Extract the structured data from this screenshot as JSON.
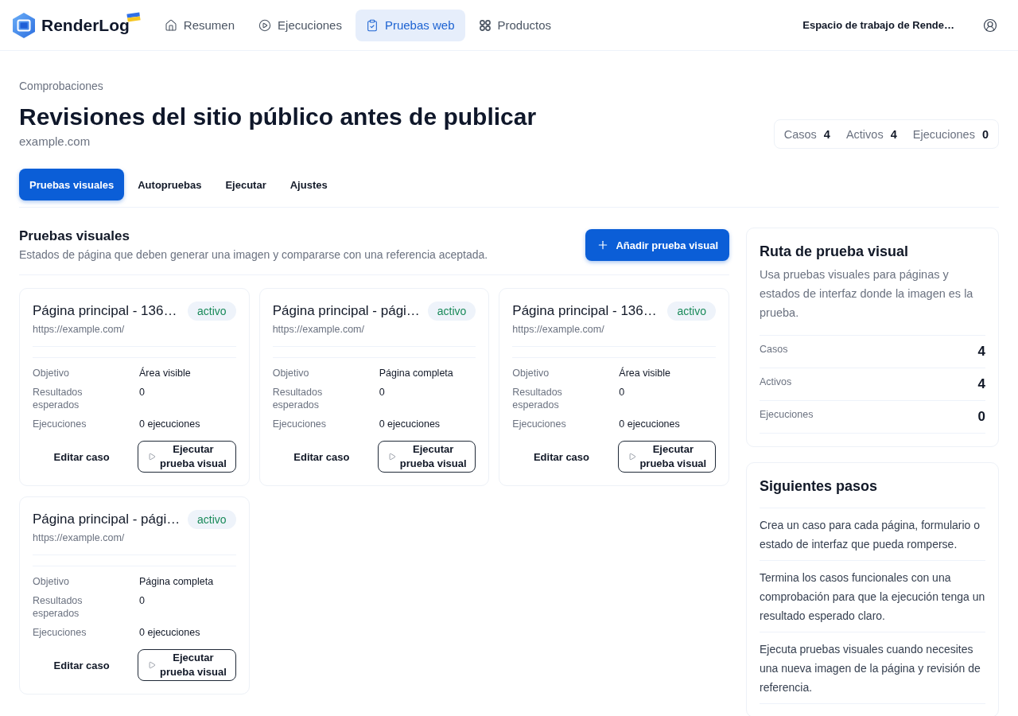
{
  "header": {
    "logo": "RenderLog",
    "nav": [
      {
        "label": "Resumen",
        "selected": false
      },
      {
        "label": "Ejecuciones",
        "selected": false
      },
      {
        "label": "Pruebas web",
        "selected": true
      },
      {
        "label": "Productos",
        "selected": false
      }
    ],
    "workspace": "Espacio de trabajo de Rende…"
  },
  "page": {
    "eyebrow": "Comprobaciones",
    "title": "Revisiones del sitio público antes de publicar",
    "domain": "example.com",
    "stats": [
      {
        "label": "Casos",
        "value": "4"
      },
      {
        "label": "Activos",
        "value": "4"
      },
      {
        "label": "Ejecuciones",
        "value": "0"
      }
    ]
  },
  "tabs": [
    {
      "label": "Pruebas visuales",
      "selected": true
    },
    {
      "label": "Autopruebas",
      "selected": false
    },
    {
      "label": "Ejecutar",
      "selected": false
    },
    {
      "label": "Ajustes",
      "selected": false
    }
  ],
  "section": {
    "title": "Pruebas visuales",
    "description": "Estados de página que deben generar una imagen y compararse con una referencia aceptada.",
    "add_button": "Añadir prueba visual"
  },
  "cases": [
    {
      "title": "Página principal - 136…",
      "status": "activo",
      "url": "https://example.com/",
      "details": [
        {
          "label": "Objetivo",
          "value": "Área visible"
        },
        {
          "label": "Resultados esperados",
          "value": "0"
        },
        {
          "label": "Ejecuciones",
          "value": "0 ejecuciones"
        }
      ],
      "edit_button": "Editar caso",
      "run_button": "Ejecutar prueba visual"
    },
    {
      "title": "Página principal - pági…",
      "status": "activo",
      "url": "https://example.com/",
      "details": [
        {
          "label": "Objetivo",
          "value": "Página completa"
        },
        {
          "label": "Resultados esperados",
          "value": "0"
        },
        {
          "label": "Ejecuciones",
          "value": "0 ejecuciones"
        }
      ],
      "edit_button": "Editar caso",
      "run_button": "Ejecutar prueba visual"
    },
    {
      "title": "Página principal - 136…",
      "status": "activo",
      "url": "https://example.com/",
      "details": [
        {
          "label": "Objetivo",
          "value": "Área visible"
        },
        {
          "label": "Resultados esperados",
          "value": "0"
        },
        {
          "label": "Ejecuciones",
          "value": "0 ejecuciones"
        }
      ],
      "edit_button": "Editar caso",
      "run_button": "Ejecutar prueba visual"
    },
    {
      "title": "Página principal - pági…",
      "status": "activo",
      "url": "https://example.com/",
      "details": [
        {
          "label": "Objetivo",
          "value": "Página completa"
        },
        {
          "label": "Resultados esperados",
          "value": "0"
        },
        {
          "label": "Ejecuciones",
          "value": "0 ejecuciones"
        }
      ],
      "edit_button": "Editar caso",
      "run_button": "Ejecutar prueba visual"
    }
  ],
  "sidebar": {
    "route_card": {
      "title": "Ruta de prueba visual",
      "description": "Usa pruebas visuales para páginas y estados de interfaz donde la imagen es la prueba.",
      "stats": [
        {
          "label": "Casos",
          "value": "4"
        },
        {
          "label": "Activos",
          "value": "4"
        },
        {
          "label": "Ejecuciones",
          "value": "0"
        }
      ]
    },
    "next_steps": {
      "title": "Siguientes pasos",
      "items": [
        "Crea un caso para cada página, formulario o estado de interfaz que pueda romperse.",
        "Termina los casos funcionales con una comprobación para que la ejecución tenga un resultado esperado claro.",
        "Ejecuta pruebas visuales cuando necesites una nueva imagen de la página y revisión de referencia."
      ]
    }
  }
}
